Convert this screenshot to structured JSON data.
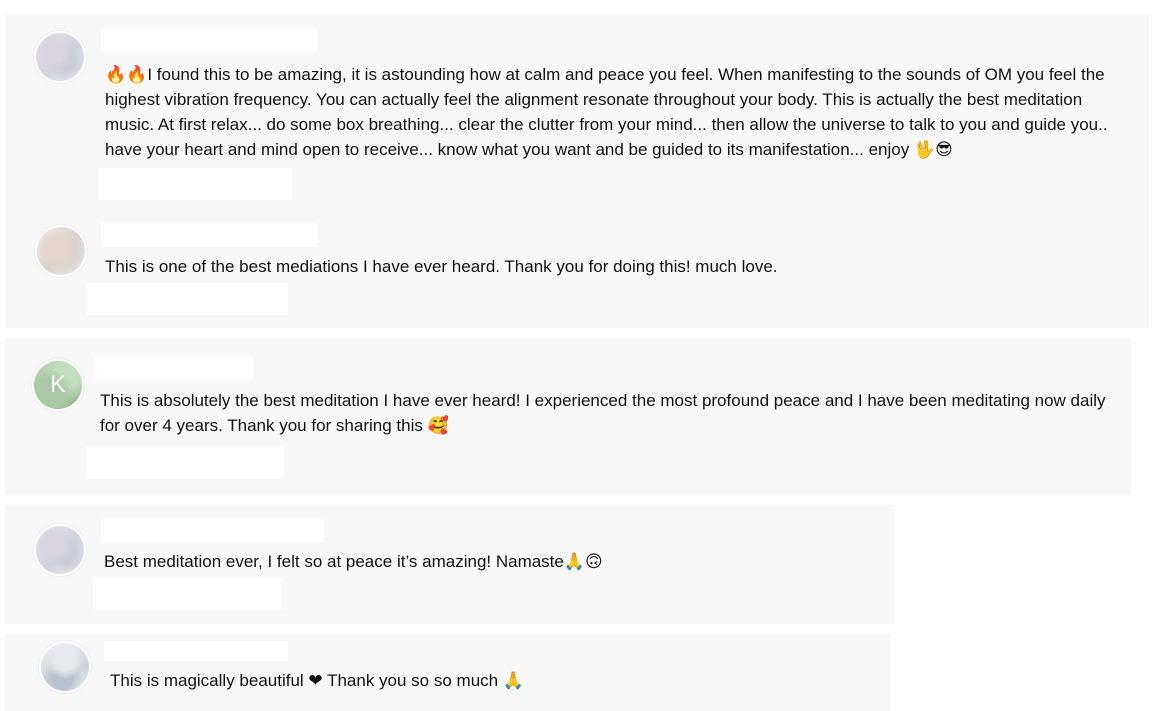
{
  "comments": [
    {
      "avatar_icon": "user-avatar-icon",
      "text": "🔥🔥I found this to be amazing, it is astounding how at calm and peace you feel. When manifesting to the sounds of OM you feel the highest vibration frequency. You can actually feel the alignment resonate throughout your body. This is actually the best meditation music. At first relax... do some box breathing... clear the clutter from your mind... then allow the universe to talk to you and guide you.. have your heart and mind open to receive... know what you want and be guided to its manifestation... enjoy 🖖😎"
    },
    {
      "avatar_icon": "user-avatar-icon",
      "text": "This is one of the best mediations I have ever heard. Thank you for doing this! much love."
    },
    {
      "avatar_letter": "K",
      "text": "This is absolutely the best meditation I have ever heard! I experienced the most profound peace and I have been meditating now daily for over 4 years. Thank you for sharing this 🥰"
    },
    {
      "avatar_icon": "user-avatar-icon",
      "text": "Best meditation ever, I felt so at peace it’s amazing! Namaste🙏🙃"
    },
    {
      "avatar_icon": "user-avatar-icon",
      "text": "This is magically beautiful ❤ Thank you so so much 🙏"
    }
  ],
  "colors": {
    "card_background": "#f8f8f8",
    "text": "#111111",
    "page_background": "#ffffff"
  }
}
